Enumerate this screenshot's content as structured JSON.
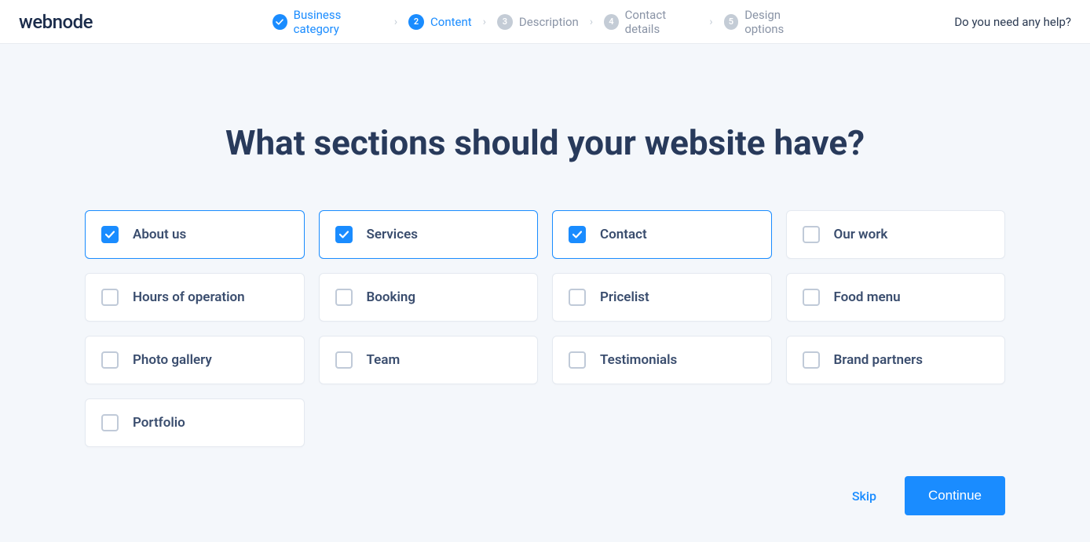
{
  "logo": "webnode",
  "helpLink": "Do you need any help?",
  "steps": [
    {
      "label": "Business category",
      "state": "done"
    },
    {
      "label": "Content",
      "state": "active",
      "num": "2"
    },
    {
      "label": "Description",
      "state": "inactive",
      "num": "3"
    },
    {
      "label": "Contact details",
      "state": "inactive",
      "num": "4"
    },
    {
      "label": "Design options",
      "state": "inactive",
      "num": "5"
    }
  ],
  "title": "What sections should your website have?",
  "options": [
    {
      "label": "About us",
      "checked": true
    },
    {
      "label": "Services",
      "checked": true
    },
    {
      "label": "Contact",
      "checked": true
    },
    {
      "label": "Our work",
      "checked": false
    },
    {
      "label": "Hours of operation",
      "checked": false
    },
    {
      "label": "Booking",
      "checked": false
    },
    {
      "label": "Pricelist",
      "checked": false
    },
    {
      "label": "Food menu",
      "checked": false
    },
    {
      "label": "Photo gallery",
      "checked": false
    },
    {
      "label": "Team",
      "checked": false
    },
    {
      "label": "Testimonials",
      "checked": false
    },
    {
      "label": "Brand partners",
      "checked": false
    },
    {
      "label": "Portfolio",
      "checked": false
    }
  ],
  "footer": {
    "skip": "Skip",
    "continue": "Continue"
  }
}
